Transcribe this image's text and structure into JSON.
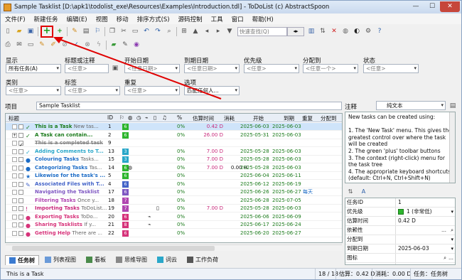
{
  "window": {
    "title": "Sample Tasklist [D:\\apk1\\todolist_exe\\Resources\\Examples\\Introduction.tdl] - ToDoList (c) AbstractSpoon"
  },
  "menu": [
    "文件(F)",
    "新建任务",
    "编辑(E)",
    "视图",
    "移动",
    "排序方式(S)",
    "源码控制",
    "工具",
    "窗口",
    "帮助(H)"
  ],
  "toolbar": {
    "quick_find_placeholder": "快速查找(Q)"
  },
  "filters": {
    "show_label": "显示",
    "show_value": "所有任务(A)",
    "title_label": "标题或注释",
    "title_value": "<任意>",
    "start_label": "开始日期",
    "start_value": "<任意日期>",
    "due_label": "到期日期",
    "due_value": "<任意日期>",
    "priority_label": "优先级",
    "priority_value": "<任意>",
    "alloc_label": "分配到",
    "alloc_value": "<任意一个>",
    "status_label": "状态",
    "status_value": "<任意>",
    "category_label": "类别",
    "category_value": "<任意>",
    "tags_label": "标签",
    "tags_value": "<任意>",
    "recurrence_label": "重复",
    "recurrence_value": "<任意>",
    "options_label": "选项",
    "options_value": "匹配任何人..."
  },
  "project": {
    "label": "项目",
    "name": "Sample Tasklist"
  },
  "notes": {
    "label": "注释",
    "format": "纯文本",
    "text": [
      "New tasks can be created using:",
      "",
      "1. The 'New Task' menu. This gives the greatest control over where the task will be created",
      "2. The green 'plus' toolbar buttons",
      "3. The context (right-click) menu for the task tree",
      "4. The appropriate keyboard shortcuts",
      "(default: Ctrl+N, Ctrl+Shift+N)"
    ]
  },
  "columns": {
    "title": "标题",
    "id": "ID",
    "pct": "%",
    "est": "估算时间",
    "spent": "消耗",
    "start": "开始",
    "due": "到期",
    "recur": "重复",
    "alloc": "分配到"
  },
  "tasks": [
    {
      "title": "This is a Task",
      "comment": "New tas...",
      "id": "1",
      "prio": "6",
      "prio_color": "#2db52d",
      "pct": "0%",
      "est": "0.42 D",
      "spent": "",
      "start": "2025-06-03",
      "due": "2025-06-03",
      "recur": "",
      "color": "#1a7a1a",
      "icon": "✓",
      "sel": true
    },
    {
      "title": "A Task can contain...",
      "comment": "",
      "id": "2",
      "prio": "6",
      "prio_color": "#2db52d",
      "pct": "0%",
      "est": "26.00 D",
      "spent": "",
      "start": "2025-05-31",
      "due": "2025-06-03",
      "recur": "",
      "color": "#1a7a1a",
      "icon": "✓",
      "sel": false
    },
    {
      "title": "This is a completed task",
      "comment": "",
      "id": "9",
      "prio": "",
      "prio_color": "",
      "pct": "",
      "est": "",
      "spent": "",
      "start": "",
      "due": "",
      "recur": "",
      "color": "#888",
      "icon": "",
      "sel": false,
      "done": true
    },
    {
      "title": "Adding Comments to T...",
      "comment": "",
      "id": "13",
      "prio": "3",
      "prio_color": "#2aa7c9",
      "pct": "0%",
      "est": "7.00 D",
      "spent": "",
      "start": "2025-05-28",
      "due": "2025-06-03",
      "recur": "",
      "color": "#2aa7c9",
      "icon": "✓",
      "sel": false
    },
    {
      "title": "Colouring Tasks",
      "comment": "Tasks...",
      "id": "15",
      "prio": "3",
      "prio_color": "#2aa7c9",
      "pct": "0%",
      "est": "7.00 D",
      "spent": "",
      "start": "2025-05-28",
      "due": "2025-06-03",
      "recur": "",
      "color": "#1b6bc6",
      "icon": "●",
      "sel": false
    },
    {
      "title": "Categorizing Tasks",
      "comment": "Tas...",
      "id": "14",
      "prio": "6",
      "prio_color": "#2db52d",
      "pct": "0%",
      "est": "7.00 D",
      "spent": "0.00 H",
      "start": "2025-05-28",
      "due": "2025-06-03",
      "recur": "",
      "color": "#1b6bc6",
      "icon": "●",
      "sel": false
    },
    {
      "title": "Likewise for the task's ...",
      "comment": "",
      "id": "5",
      "prio": "6",
      "prio_color": "#2db52d",
      "pct": "0%",
      "est": "",
      "spent": "",
      "start": "2025-06-04",
      "due": "2025-06-11",
      "recur": "",
      "color": "#1b6bc6",
      "icon": "★",
      "sel": false
    },
    {
      "title": "Associated Files with T...",
      "comment": "",
      "id": "4",
      "prio": "6",
      "prio_color": "#4464c8",
      "pct": "0%",
      "est": "",
      "spent": "",
      "start": "2025-06-12",
      "due": "2025-06-19",
      "recur": "",
      "color": "#4464c8",
      "icon": "✎",
      "sel": false
    },
    {
      "title": "Navigating the Tasklist",
      "comment": "",
      "id": "17",
      "prio": "6",
      "prio_color": "#7e57c2",
      "pct": "0%",
      "est": "",
      "spent": "",
      "start": "2025-06-26",
      "due": "2025-06-27",
      "recur": "每天",
      "color": "#7e57c2",
      "icon": "",
      "sel": false
    },
    {
      "title": "Filtering Tasks",
      "comment": "Once y...",
      "id": "18",
      "prio": "7",
      "prio_color": "#b046b0",
      "pct": "0%",
      "est": "",
      "spent": "",
      "start": "2025-06-28",
      "due": "2025-07-05",
      "recur": "",
      "color": "#b046b0",
      "icon": "",
      "sel": false
    },
    {
      "title": "Importing Tasks",
      "comment": "ToDoList...",
      "id": "19",
      "prio": "7",
      "prio_color": "#b046b0",
      "pct": "0%",
      "est": "7.00 D",
      "spent": "",
      "start": "2025-05-28",
      "due": "2025-06-03",
      "recur": "",
      "color": "#c8287a",
      "icon": "!",
      "sel": false
    },
    {
      "title": "Exporting Tasks",
      "comment": "ToDo...",
      "id": "20",
      "prio": "6",
      "prio_color": "#d6337a",
      "pct": "0%",
      "est": "",
      "spent": "",
      "start": "2025-06-06",
      "due": "2025-06-09",
      "recur": "",
      "color": "#d6337a",
      "icon": "●",
      "sel": false
    },
    {
      "title": "Sharing Tasklists",
      "comment": "If y...",
      "id": "21",
      "prio": "8",
      "prio_color": "#d6337a",
      "pct": "0%",
      "est": "",
      "spent": "",
      "start": "2025-06-17",
      "due": "2025-06-24",
      "recur": "",
      "color": "#d6337a",
      "icon": "●",
      "sel": false
    },
    {
      "title": "Getting Help",
      "comment": "There are ...",
      "id": "22",
      "prio": "6",
      "prio_color": "#d6337a",
      "pct": "0%",
      "est": "",
      "spent": "",
      "start": "2025-06-20",
      "due": "2025-06-27",
      "recur": "",
      "color": "#d6337a",
      "icon": "●",
      "sel": false
    }
  ],
  "properties": [
    {
      "k": "任务ID",
      "v": "1"
    },
    {
      "k": "优先级",
      "v": "1 (非常低)"
    },
    {
      "k": "估算时间",
      "v": "0.42 D"
    },
    {
      "k": "依赖性",
      "v": ""
    },
    {
      "k": "分配到",
      "v": ""
    },
    {
      "k": "到期日期",
      "v": "2025-06-03"
    },
    {
      "k": "图标",
      "v": ""
    }
  ],
  "tabs": [
    "任务树",
    "列表视图",
    "看板",
    "思维导图",
    "词云",
    "工作负荷"
  ],
  "status": {
    "task": "This is a Task",
    "count": "18 / 18",
    "est": "估算：0.42 D",
    "spent": "消耗：0.00 D",
    "view": "任务：任务树"
  },
  "colors": {
    "highlight": "#e00000",
    "selection": "#cfe4fa"
  }
}
